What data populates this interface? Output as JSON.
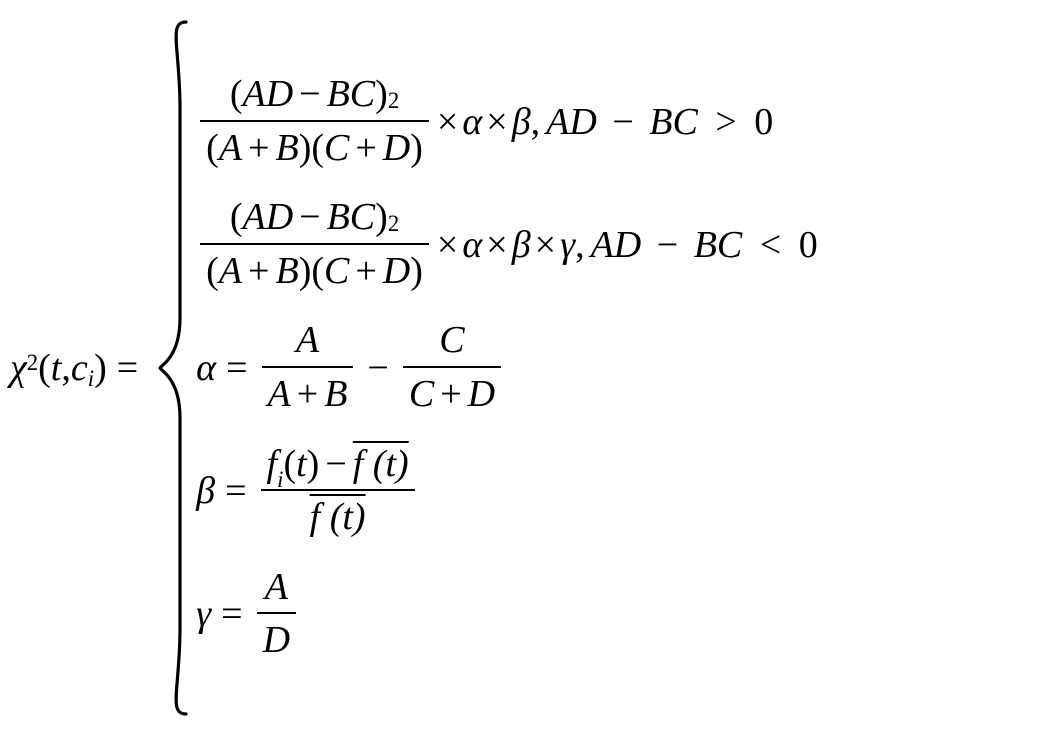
{
  "lhs": {
    "chi": "χ",
    "sq": "2",
    "open": "(",
    "t": "t",
    "comma": ",",
    "c": "c",
    "csub": "i",
    "close": ")",
    "eq": "="
  },
  "case1": {
    "num_open": "(",
    "num_expr": "AD",
    "num_minus": "−",
    "num_expr2": "BC",
    "num_close": ")",
    "num_pow": "2",
    "den_open1": "(",
    "den_a": "A",
    "den_plus1": "+",
    "den_b": "B",
    "den_close1": ")",
    "den_open2": "(",
    "den_c": "C",
    "den_plus2": "+",
    "den_d": "D",
    "den_close2": ")",
    "times1": "×",
    "alpha": "α",
    "times2": "×",
    "beta": "β",
    "comma": ",",
    "cond_left": "AD",
    "cond_minus": "−",
    "cond_right": "BC",
    "cond_op": ">",
    "cond_zero": "0"
  },
  "case2": {
    "num_open": "(",
    "num_expr": "AD",
    "num_minus": "−",
    "num_expr2": "BC",
    "num_close": ")",
    "num_pow": "2",
    "den_open1": "(",
    "den_a": "A",
    "den_plus1": "+",
    "den_b": "B",
    "den_close1": ")",
    "den_open2": "(",
    "den_c": "C",
    "den_plus2": "+",
    "den_d": "D",
    "den_close2": ")",
    "times1": "×",
    "alpha": "α",
    "times2": "×",
    "beta": "β",
    "times3": "×",
    "gamma": "γ",
    "comma": ",",
    "cond_left": "AD",
    "cond_minus": "−",
    "cond_right": "BC",
    "cond_op": "<",
    "cond_zero": "0"
  },
  "alpha_def": {
    "alpha": "α",
    "eq": "=",
    "f1_num": "A",
    "f1_den_a": "A",
    "f1_den_plus": "+",
    "f1_den_b": "B",
    "minus": "−",
    "f2_num": "C",
    "f2_den_c": "C",
    "f2_den_plus": "+",
    "f2_den_d": "D"
  },
  "beta_def": {
    "beta": "β",
    "eq": "=",
    "num_f": "f",
    "num_fsub": "i",
    "num_open": "(",
    "num_t": "t",
    "num_close": ")",
    "num_minus": "−",
    "num_fbar": "f (t)",
    "den_fbar": "f (t)"
  },
  "gamma_def": {
    "gamma": "γ",
    "eq": "=",
    "num": "A",
    "den": "D"
  }
}
